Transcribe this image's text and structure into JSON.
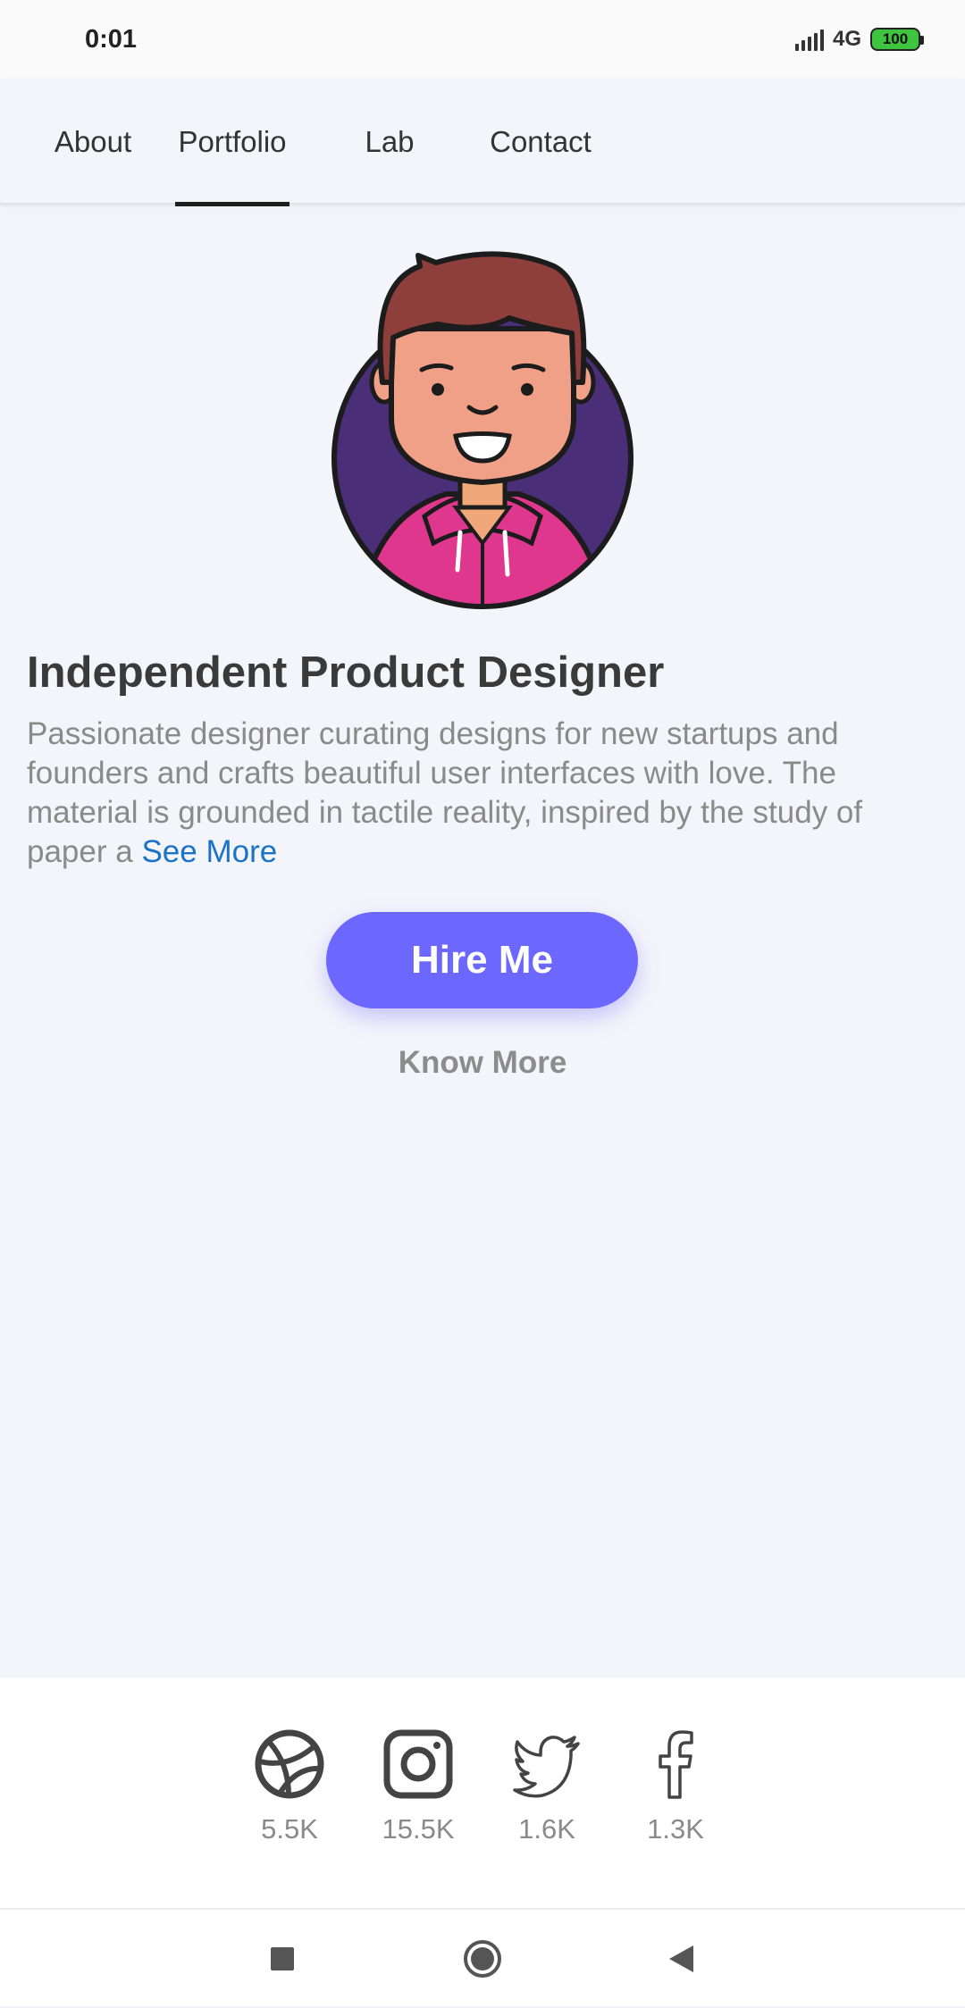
{
  "status_bar": {
    "time": "0:01",
    "network": "4G",
    "battery": "100"
  },
  "tabs": [
    {
      "label": "About",
      "active": false
    },
    {
      "label": "Portfolio",
      "active": true
    },
    {
      "label": "Lab",
      "active": false
    },
    {
      "label": "Contact",
      "active": false
    }
  ],
  "profile": {
    "headline": "Independent Product Designer",
    "bio": "Passionate designer curating designs for new startups and founders and crafts beautiful user interfaces with love. The material is grounded in tactile reality, inspired by the study of paper a",
    "see_more": "See More"
  },
  "actions": {
    "hire_label": "Hire Me",
    "know_more_label": "Know More"
  },
  "social": [
    {
      "icon": "dribbble-icon",
      "count": "5.5K"
    },
    {
      "icon": "instagram-icon",
      "count": "15.5K"
    },
    {
      "icon": "twitter-icon",
      "count": "1.6K"
    },
    {
      "icon": "facebook-icon",
      "count": "1.3K"
    }
  ],
  "colors": {
    "accent": "#6c67ff",
    "link": "#1a73c9",
    "background": "#f4f5fa"
  }
}
